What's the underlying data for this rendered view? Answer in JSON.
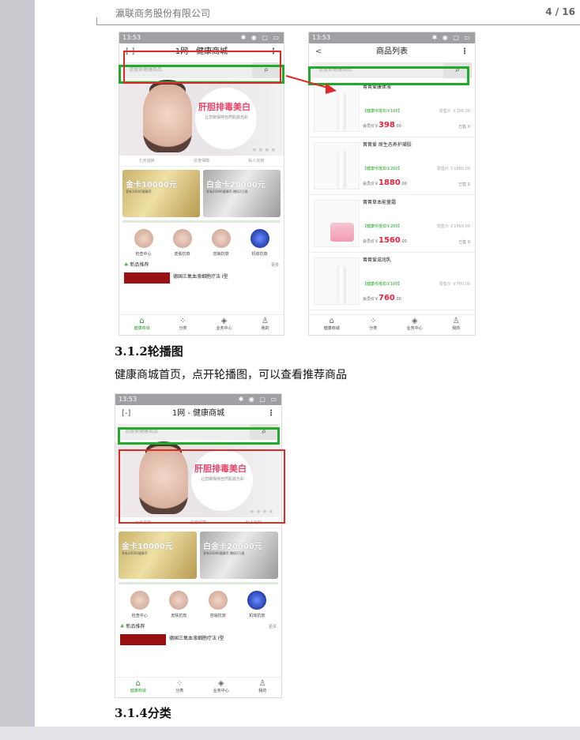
{
  "header": {
    "company": "瀛联商务股份有限公司",
    "page": "4 / 16"
  },
  "phone1": {
    "status_time": "13:53",
    "title": "1网 - 健康商城",
    "scan_icon": "[-]",
    "menu_icon": "⋮",
    "search_placeholder": "请搜索健康商品",
    "banner_title": "肝胆排毒美白",
    "banner_sub": "让您做保持自然肌底光彩",
    "features": [
      "七天退换",
      "信誉保障",
      "私人定制"
    ],
    "gold_card": {
      "title": "金卡10000元",
      "sub": "享有10000健康币"
    },
    "plat_card": {
      "title": "白金卡20000元",
      "sub": "享有20000健康币 赠权2万报"
    },
    "categories": [
      "检查中心",
      "皮肤抗衰",
      "容貌抗衰",
      "机体抗衰"
    ],
    "new_label": "新品推荐",
    "more_label": "更多",
    "product_title": "德国三氧血液细胞疗法 I型",
    "tabs": [
      "健康商城",
      "分类",
      "业务中心",
      "我的"
    ]
  },
  "phone2": {
    "status_time": "13:53",
    "back_icon": "<",
    "title": "商品列表",
    "menu_icon": "⋮",
    "search_placeholder": "请搜索健康商品",
    "items": [
      {
        "name": "菁菁爱康体液",
        "coin": "【健康币抵扣￥100】",
        "retail": "零售价 ￥398.00",
        "member_label": "会员价￥",
        "member_price": "398",
        "member_cents": ".00",
        "sold": "已售 0"
      },
      {
        "name": "菁菁爱 原生态养护凝胶",
        "coin": "【健康币抵扣￥200】",
        "retail": "零售价 ￥1880.00",
        "member_label": "会员价￥",
        "member_price": "1880",
        "member_cents": ".00",
        "sold": "已售 0"
      },
      {
        "name": "菁菁草本能量霜",
        "coin": "【健康币抵扣￥200】",
        "retail": "零售价 ￥1560.00",
        "member_label": "会员价￥",
        "member_price": "1560",
        "member_cents": ".00",
        "sold": "已售 0"
      },
      {
        "name": "菁菁爱滋润乳",
        "coin": "【健康币抵扣￥100】",
        "retail": "零售价 ￥760.00",
        "member_label": "会员价￥",
        "member_price": "760",
        "member_cents": ".00",
        "sold": ""
      }
    ],
    "tabs": [
      "健康商城",
      "分类",
      "业务中心",
      "我的"
    ]
  },
  "section1": {
    "heading": "3.1.2轮播图",
    "body": "健康商城首页，点开轮播图，可以查看推荐商品"
  },
  "section2": {
    "heading": "3.1.4分类"
  }
}
